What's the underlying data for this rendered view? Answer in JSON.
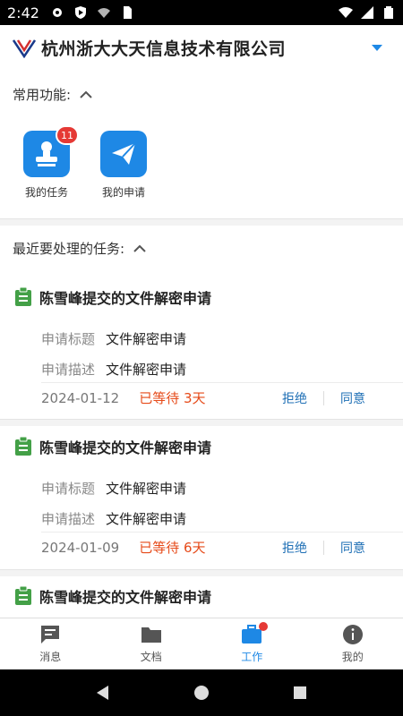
{
  "status_bar": {
    "time": "2:42"
  },
  "header": {
    "company": "杭州浙大大天信息技术有限公司"
  },
  "common_functions": {
    "label": "常用功能:",
    "items": [
      {
        "label": "我的任务",
        "badge": "11",
        "icon": "stamp-icon"
      },
      {
        "label": "我的申请",
        "icon": "paper-plane-icon"
      }
    ]
  },
  "recent_tasks": {
    "label": "最近要处理的任务:",
    "key_title": "申请标题",
    "key_desc": "申请描述",
    "reject_label": "拒绝",
    "approve_label": "同意",
    "items": [
      {
        "title": "陈雪峰提交的文件解密申请",
        "apply_title": "文件解密申请",
        "apply_desc": "文件解密申请",
        "date": "2024-01-12",
        "wait": "已等待 3天"
      },
      {
        "title": "陈雪峰提交的文件解密申请",
        "apply_title": "文件解密申请",
        "apply_desc": "文件解密申请",
        "date": "2024-01-09",
        "wait": "已等待 6天"
      },
      {
        "title": "陈雪峰提交的文件解密申请"
      }
    ]
  },
  "tabbar": {
    "tabs": [
      {
        "label": "消息",
        "icon": "message-icon"
      },
      {
        "label": "文档",
        "icon": "folder-icon"
      },
      {
        "label": "工作",
        "icon": "briefcase-icon",
        "active": true
      },
      {
        "label": "我的",
        "icon": "info-icon"
      }
    ]
  },
  "colors": {
    "accent": "#1e88e5",
    "badge": "#e53935",
    "wait": "#e64a19",
    "task_icon": "#43a047"
  }
}
